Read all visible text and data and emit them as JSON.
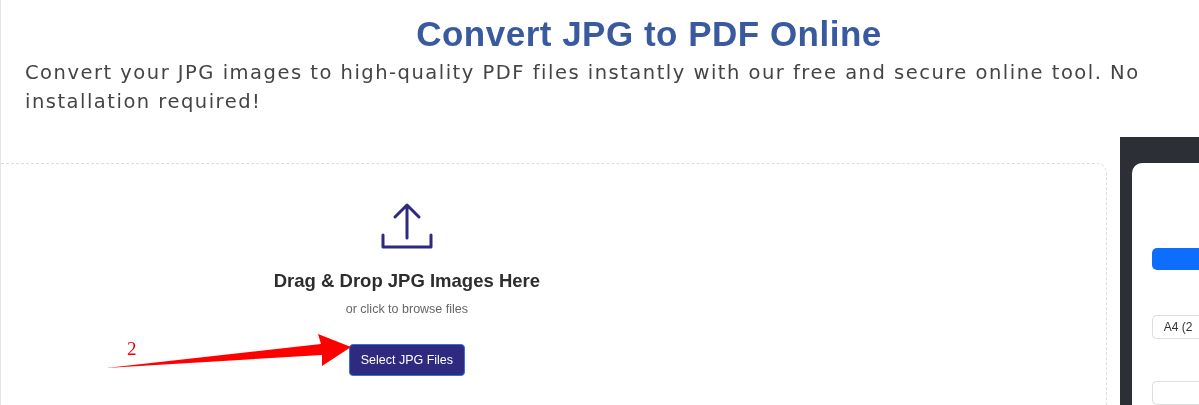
{
  "header": {
    "title": "Convert JPG to PDF Online",
    "description": "Convert your JPG images to high-quality PDF files instantly with our free and secure online tool. No installation required!"
  },
  "upload": {
    "heading": "Drag & Drop JPG Images Here",
    "hint": "or click to browse files",
    "button": "Select JPG Files"
  },
  "annotation": {
    "label": "2"
  },
  "settings": {
    "page_size": "A4 (2"
  }
}
